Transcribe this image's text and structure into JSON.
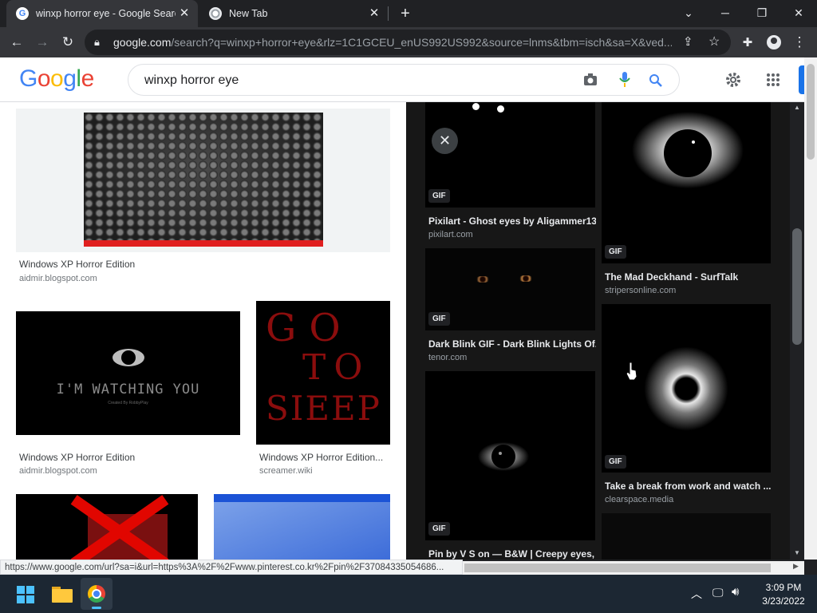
{
  "browser": {
    "tabs": [
      {
        "title": "winxp horror eye - Google Search",
        "active": true
      },
      {
        "title": "New Tab",
        "active": false
      }
    ],
    "new_tab": "+",
    "url_host": "google.com",
    "url_path": "/search?q=winxp+horror+eye&rlz=1C1GCEU_enUS992US992&source=lnms&tbm=isch&sa=X&ved...",
    "icons": [
      "back-icon",
      "forward-icon",
      "reload-icon",
      "lock-icon",
      "share-icon",
      "star-icon",
      "extensions-icon",
      "profile-icon",
      "menu-icon"
    ]
  },
  "google": {
    "logo": [
      "G",
      "o",
      "o",
      "g",
      "l",
      "e"
    ],
    "logo_colors": [
      "#4285f4",
      "#ea4335",
      "#fbbc05",
      "#4285f4",
      "#34a853",
      "#ea4335"
    ],
    "query": "winxp horror eye"
  },
  "results": [
    {
      "title": "Windows XP Horror Edition",
      "source": "aidmir.blogspot.com"
    },
    {
      "title": "Windows XP Horror Edition",
      "source": "aidmir.blogspot.com"
    },
    {
      "title": "Windows XP Horror Edition...",
      "source": "screamer.wiki"
    }
  ],
  "image_text": {
    "watching": "I'M WATCHING YOU",
    "created_by": "Created By RobbyPlay",
    "go_to_sleep": [
      "GO",
      "TO",
      "SIEEP"
    ]
  },
  "panel": {
    "badge": "GIF",
    "items": [
      {
        "title": "Pixilart - Ghost eyes by Aligammer13",
        "source": "pixilart.com"
      },
      {
        "title": "The Mad Deckhand - SurfTalk",
        "source": "stripersonline.com"
      },
      {
        "title": "Dark Blink GIF - Dark Blink Lights Of...",
        "source": "tenor.com"
      },
      {
        "title": "Take a break from work and watch ...",
        "source": "clearspace.media"
      },
      {
        "title": "Pin by V S on — B&W | Creepy eyes, ...",
        "source": ""
      }
    ],
    "close_symbol": "✕"
  },
  "status_url": "https://www.google.com/url?sa=i&url=https%3A%2F%2Fwww.pinterest.co.kr%2Fpin%2F37084335054686...",
  "taskbar": {
    "time": "3:09 PM",
    "date": "3/23/2022"
  }
}
